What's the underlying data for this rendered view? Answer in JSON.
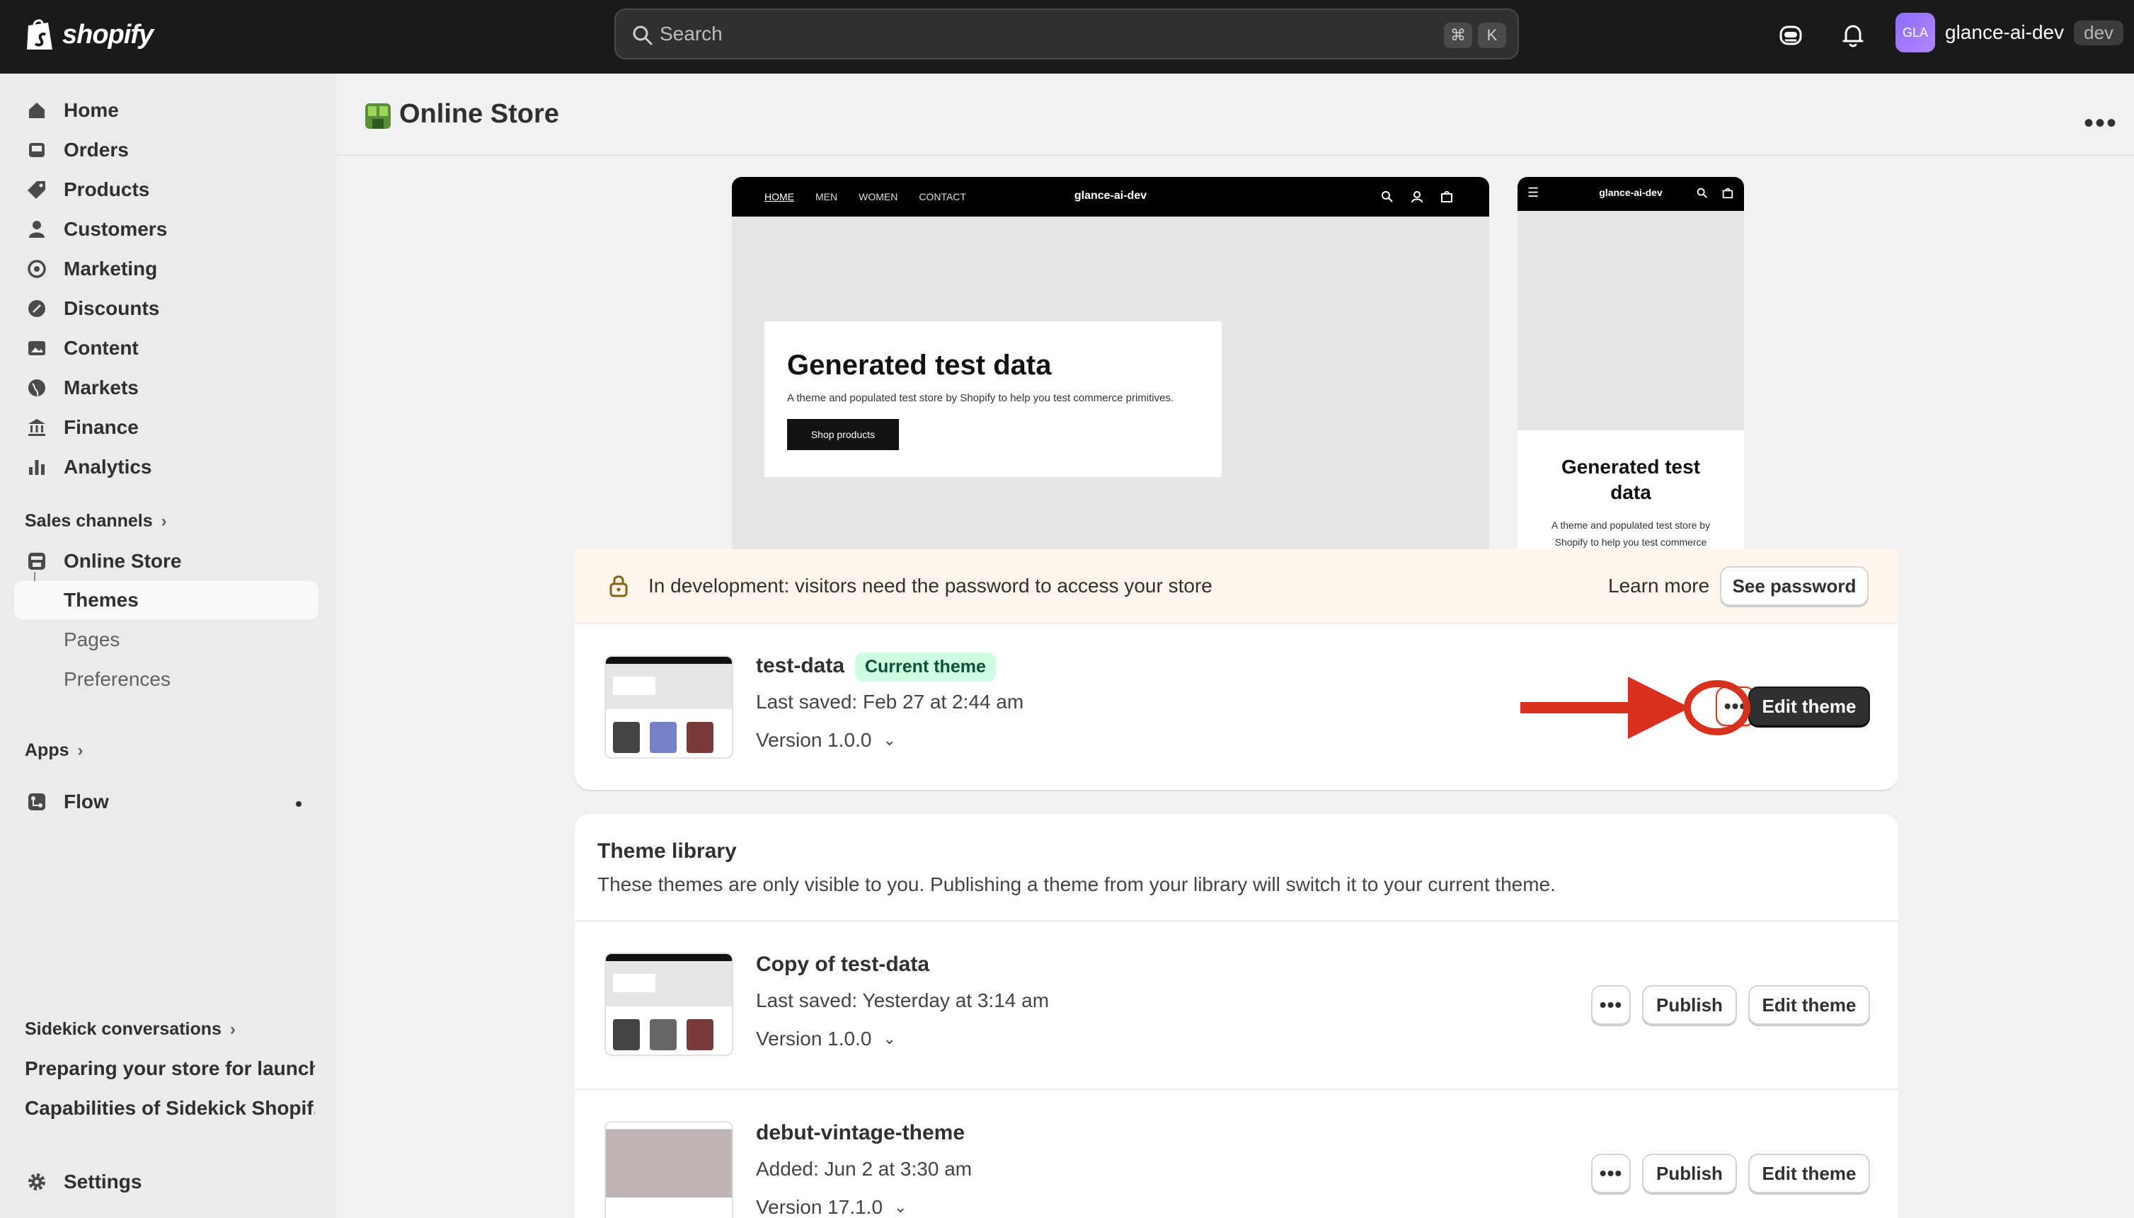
{
  "topbar": {
    "logo_text": "shopify",
    "search_placeholder": "Search",
    "shortcut_cmd": "⌘",
    "shortcut_key": "K",
    "user_initials": "GLA",
    "user_name": "glance-ai-dev",
    "user_badge": "dev"
  },
  "sidebar": {
    "items": [
      {
        "label": "Home",
        "icon": "home-icon"
      },
      {
        "label": "Orders",
        "icon": "inbox-icon"
      },
      {
        "label": "Products",
        "icon": "tag-icon"
      },
      {
        "label": "Customers",
        "icon": "person-icon"
      },
      {
        "label": "Marketing",
        "icon": "target-icon"
      },
      {
        "label": "Discounts",
        "icon": "discount-icon"
      },
      {
        "label": "Content",
        "icon": "image-icon"
      },
      {
        "label": "Markets",
        "icon": "globe-icon"
      },
      {
        "label": "Finance",
        "icon": "bank-icon"
      },
      {
        "label": "Analytics",
        "icon": "bar-chart-icon"
      }
    ],
    "sales_channels": "Sales channels",
    "online_store": "Online Store",
    "themes": "Themes",
    "pages": "Pages",
    "preferences": "Preferences",
    "apps": "Apps",
    "flow": "Flow",
    "sidekick_head": "Sidekick conversations",
    "conversations": [
      "Preparing your store for launch",
      "Capabilities of Sidekick Shopif..."
    ],
    "settings": "Settings"
  },
  "page": {
    "title": "Online Store",
    "more": "•••"
  },
  "preview": {
    "nav": [
      "HOME",
      "MEN",
      "WOMEN",
      "CONTACT"
    ],
    "brand": "glance-ai-dev",
    "hero_title": "Generated test data",
    "hero_sub": "A theme and populated test store by Shopify to help you test commerce primitives.",
    "hero_button": "Shop products",
    "mobile_title": "Generated test data",
    "mobile_sub": "A theme and populated test store by Shopify to help you test commerce"
  },
  "banner": {
    "text": "In development: visitors need the password to access your store",
    "learn_more": "Learn more",
    "see_password": "See password"
  },
  "current_theme": {
    "name": "test-data",
    "badge": "Current theme",
    "saved": "Last saved: Feb 27 at 2:44 am",
    "version": "Version 1.0.0",
    "more": "•••",
    "edit": "Edit theme"
  },
  "library": {
    "title": "Theme library",
    "subtitle": "These themes are only visible to you. Publishing a theme from your library will switch it to your current theme.",
    "themes": [
      {
        "name": "Copy of test-data",
        "meta": "Last saved: Yesterday at 3:14 am",
        "version": "Version 1.0.0",
        "more": "•••",
        "publish": "Publish",
        "edit": "Edit theme"
      },
      {
        "name": "debut-vintage-theme",
        "meta": "Added: Jun 2 at 3:30 am",
        "version": "Version 17.1.0",
        "more": "•••",
        "publish": "Publish",
        "edit": "Edit theme"
      }
    ]
  },
  "colors": {
    "topbar": "#1a1a1a",
    "annotation": "#d8321e",
    "badge_green": "#cdfee1",
    "banner_bg": "#fff5ea"
  }
}
